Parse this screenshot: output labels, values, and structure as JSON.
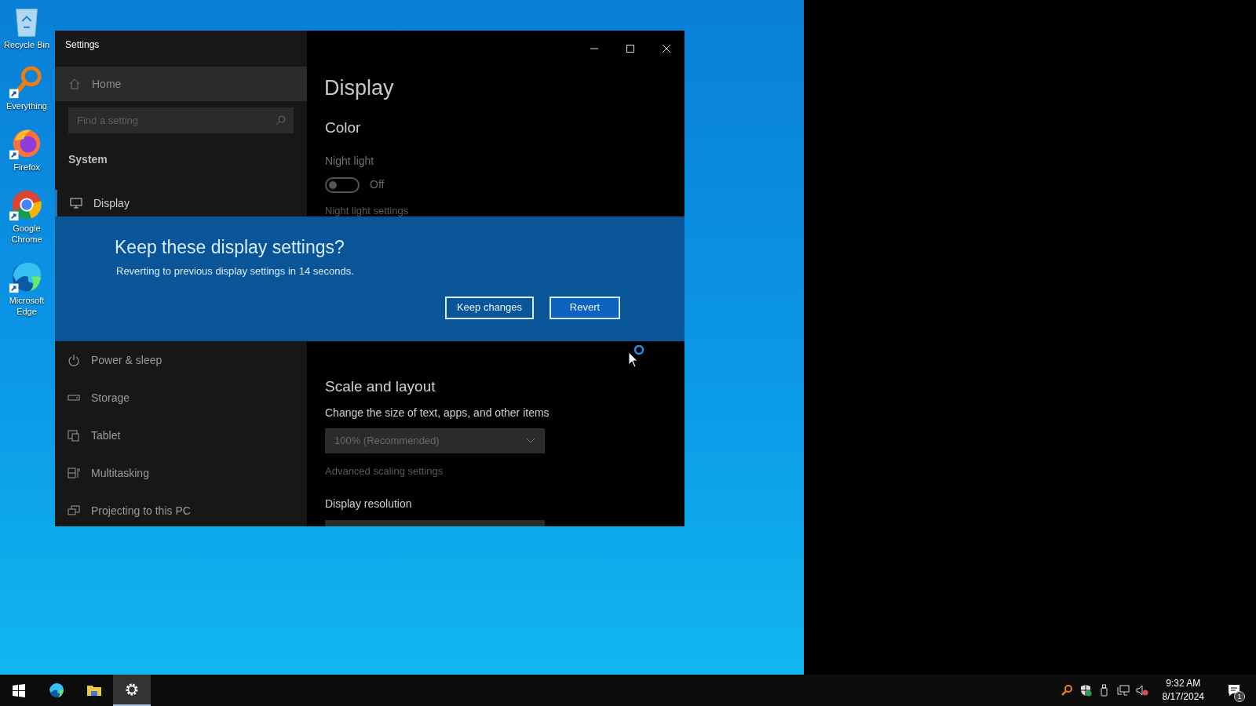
{
  "desktop_icons": [
    {
      "kind": "recycle",
      "label": "Recycle Bin",
      "shortcut": false
    },
    {
      "kind": "everything",
      "label": "Everything",
      "shortcut": true
    },
    {
      "kind": "firefox",
      "label": "Firefox",
      "shortcut": true
    },
    {
      "kind": "chrome",
      "label": "Google Chrome",
      "shortcut": true
    },
    {
      "kind": "edge",
      "label": "Microsoft Edge",
      "shortcut": true
    }
  ],
  "window": {
    "title": "Settings",
    "sidebar": {
      "home": "Home",
      "search_placeholder": "Find a setting",
      "section": "System",
      "items_top": [
        {
          "kind": "display",
          "label": "Display",
          "selected": true
        }
      ],
      "items_bottom": [
        {
          "kind": "power",
          "label": "Power & sleep",
          "selected": false
        },
        {
          "kind": "storage",
          "label": "Storage",
          "selected": false
        },
        {
          "kind": "tablet",
          "label": "Tablet",
          "selected": false
        },
        {
          "kind": "multitasking",
          "label": "Multitasking",
          "selected": false
        },
        {
          "kind": "projecting",
          "label": "Projecting to this PC",
          "selected": false
        }
      ]
    },
    "content_top": {
      "page_title": "Display",
      "color_heading": "Color",
      "night_light_label": "Night light",
      "night_light_toggle": {
        "on": false,
        "state_label": "Off"
      },
      "night_light_link": "Night light settings"
    },
    "dialog": {
      "title": "Keep these display settings?",
      "message": "Reverting to previous display settings in 14 seconds.",
      "buttons": [
        {
          "label": "Keep changes",
          "focused": false
        },
        {
          "label": "Revert",
          "focused": true
        }
      ]
    },
    "content_bottom": {
      "scale_heading": "Scale and layout",
      "scale_label": "Change the size of text, apps, and other items",
      "scale_dropdown": "100% (Recommended)",
      "advanced_link": "Advanced scaling settings",
      "resolution_label": "Display resolution"
    }
  },
  "taskbar": {
    "apps": [
      {
        "kind": "start",
        "active": false
      },
      {
        "kind": "edge",
        "active": false
      },
      {
        "kind": "explorer",
        "active": false
      },
      {
        "kind": "settings",
        "active": true
      }
    ],
    "tray": [
      {
        "kind": "everything"
      },
      {
        "kind": "defender"
      },
      {
        "kind": "usb"
      },
      {
        "kind": "network"
      },
      {
        "kind": "volume-muted"
      }
    ],
    "time": "9:32 AM",
    "date": "8/17/2024",
    "notification_count": "1"
  }
}
